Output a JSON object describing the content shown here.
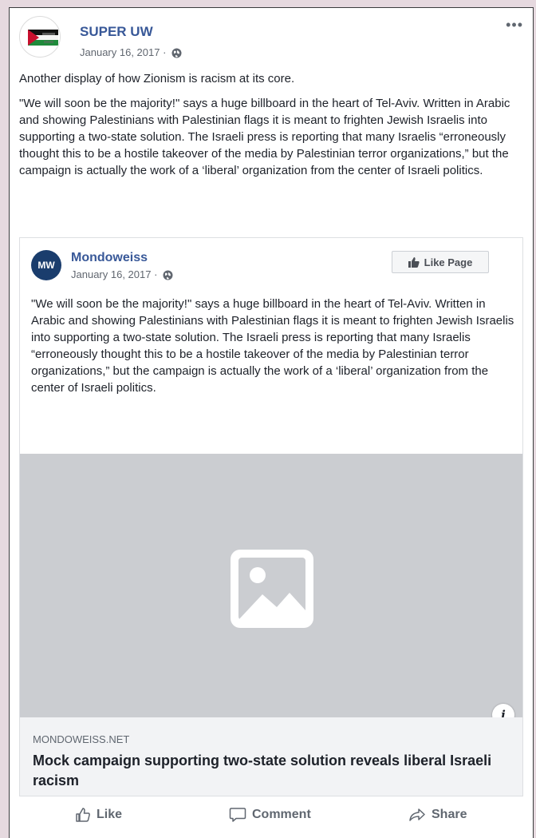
{
  "post": {
    "author": "SUPER UW",
    "date": "January 16, 2017 ·",
    "more": "•••",
    "caption": [
      "Another display of how Zionism is racism at its core.",
      "\"We will soon be the majority!\" says a huge billboard in the heart of Tel-Aviv. Written in Arabic and showing Palestinians with Palestinian flags it is meant to frighten Jewish Israelis into supporting a two-state solution. The Israeli press is reporting that many Israelis “erroneously thought this to be a hostile takeover of the media by Palestinian terror organizations,” but the campaign is actually the work of a ‘liberal’ organization from the center of Israeli politics."
    ]
  },
  "shared": {
    "avatar_text": "MW",
    "page_name": "Mondoweiss",
    "date": "January 16, 2017 ·",
    "like_page_label": "Like Page",
    "text": "\"We will soon be the majority!\" says a huge billboard in the heart of Tel-Aviv. Written in Arabic and showing Palestinians with Palestinian flags it is meant to frighten Jewish Israelis into supporting a two-state solution. The Israeli press is reporting that many Israelis “erroneously thought this to be a hostile takeover of the media by Palestinian terror organizations,” but the campaign is actually the work of a ‘liberal’ organization from the center of Israeli politics.",
    "info": "i",
    "link": {
      "domain": "MONDOWEISS.NET",
      "title": "Mock campaign supporting two-state solution reveals liberal Israeli racism"
    }
  },
  "actions": {
    "like": "Like",
    "comment": "Comment",
    "share": "Share"
  },
  "colors": {
    "page_background": "#e6d9df",
    "link_blue": "#385898",
    "image_placeholder": "#cbcdd1"
  }
}
